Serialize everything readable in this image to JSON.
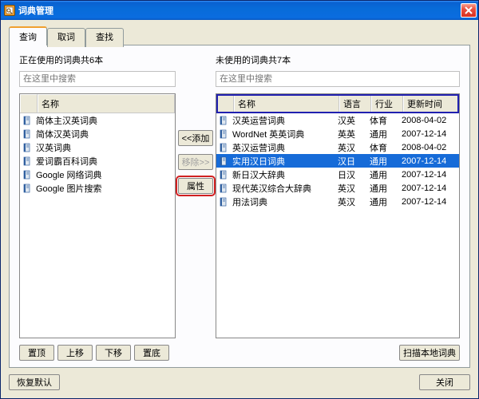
{
  "window": {
    "title": "词典管理"
  },
  "tabs": {
    "t0": "查询",
    "t1": "取词",
    "t2": "查找"
  },
  "left": {
    "label": "正在使用的词典共6本",
    "placeholder": "在这里中搜索",
    "header": {
      "name": "名称"
    },
    "rows": [
      {
        "name": "简体主汉英词典"
      },
      {
        "name": "简体汉英词典"
      },
      {
        "name": "汉英词典"
      },
      {
        "name": "爱词霸百科词典"
      },
      {
        "name": "Google 网络词典"
      },
      {
        "name": "Google 图片搜索"
      }
    ]
  },
  "mid": {
    "add": "<<添加",
    "remove": "移除>>",
    "prop": "属性"
  },
  "right": {
    "label": "未使用的词典共7本",
    "placeholder": "在这里中搜索",
    "header": {
      "name": "名称",
      "lang": "语言",
      "industry": "行业",
      "update": "更新时间"
    },
    "rows": [
      {
        "name": "汉英运营词典",
        "lang": "汉英",
        "industry": "体育",
        "update": "2008-04-02"
      },
      {
        "name": "WordNet 英英词典",
        "lang": "英英",
        "industry": "通用",
        "update": "2007-12-14"
      },
      {
        "name": "英汉运营词典",
        "lang": "英汉",
        "industry": "体育",
        "update": "2008-04-02"
      },
      {
        "name": "实用汉日词典",
        "lang": "汉日",
        "industry": "通用",
        "update": "2007-12-14"
      },
      {
        "name": "新日汉大辞典",
        "lang": "日汉",
        "industry": "通用",
        "update": "2007-12-14"
      },
      {
        "name": "现代英汉综合大辞典",
        "lang": "英汉",
        "industry": "通用",
        "update": "2007-12-14"
      },
      {
        "name": "用法词典",
        "lang": "英汉",
        "industry": "通用",
        "update": "2007-12-14"
      }
    ],
    "selected_index": 3
  },
  "bottom": {
    "top": "置顶",
    "up": "上移",
    "down": "下移",
    "bottom": "置底",
    "scan": "扫描本地词典"
  },
  "footer": {
    "restore": "恢复默认",
    "close": "关闭"
  }
}
